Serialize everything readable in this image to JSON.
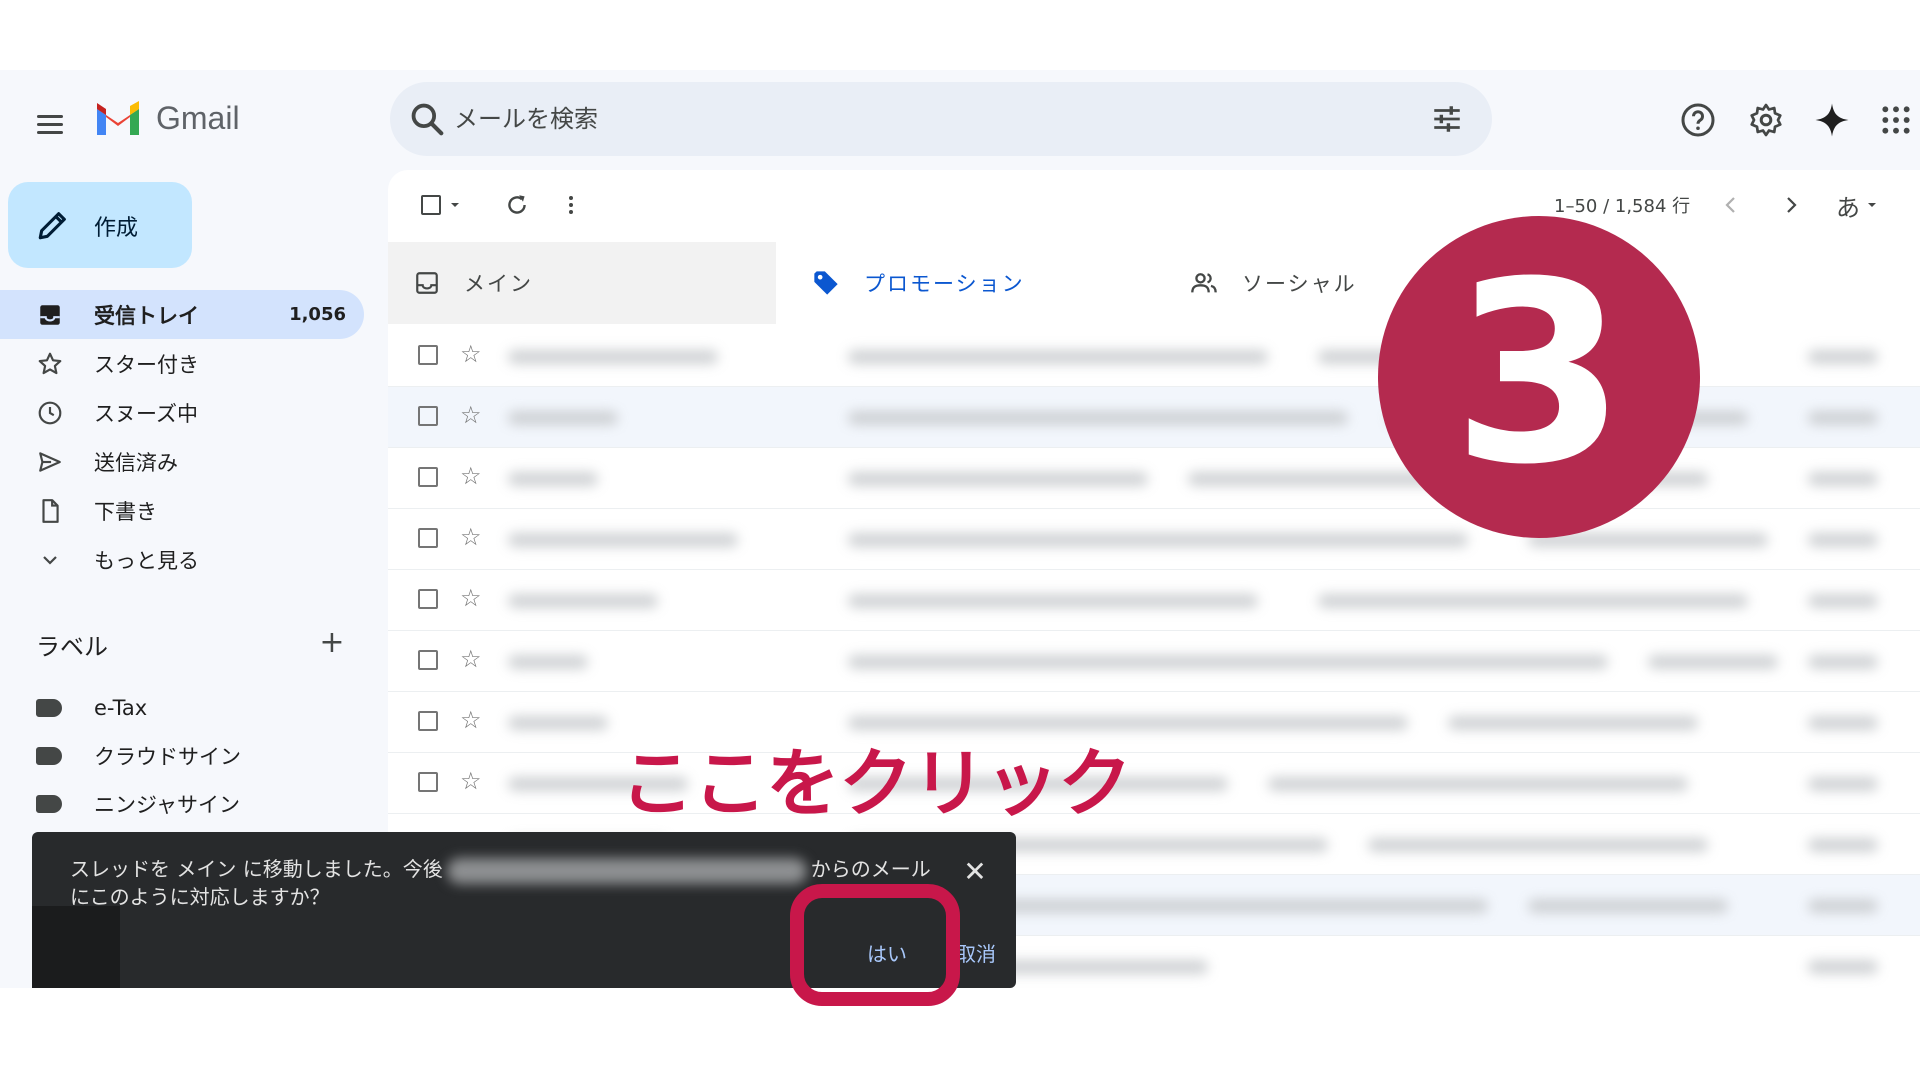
{
  "app": {
    "name": "Gmail"
  },
  "search": {
    "placeholder": "メールを検索"
  },
  "compose": {
    "label": "作成"
  },
  "sidebar": {
    "items": [
      {
        "label": "受信トレイ",
        "count": "1,056",
        "icon": "inbox-icon"
      },
      {
        "label": "スター付き",
        "icon": "star-icon"
      },
      {
        "label": "スヌーズ中",
        "icon": "clock-icon"
      },
      {
        "label": "送信済み",
        "icon": "send-icon"
      },
      {
        "label": "下書き",
        "icon": "draft-icon"
      },
      {
        "label": "もっと見る",
        "icon": "chevron-down-icon"
      }
    ],
    "labels_title": "ラベル",
    "labels": [
      "e-Tax",
      "クラウドサイン",
      "ニンジャサイン"
    ]
  },
  "toolbar": {
    "pager": "1–50 / 1,584 行",
    "input_mode": "あ"
  },
  "tabs": [
    {
      "label": "メイン",
      "icon": "inbox-icon"
    },
    {
      "label": "プロモーション",
      "icon": "tag-icon"
    },
    {
      "label": "ソーシャル",
      "icon": "people-icon"
    }
  ],
  "snackbar": {
    "message_part1": "スレッドを メイン に移動しました。今後",
    "message_part2": "からのメールにこのように対応しますか？",
    "yes": "はい",
    "undo": "取消"
  },
  "annotation": {
    "caption": "ここをクリック",
    "step": "3"
  },
  "colors": {
    "accent": "#0b57d0",
    "annotation": "#c8174a",
    "step_circle": "#b42a4f"
  }
}
